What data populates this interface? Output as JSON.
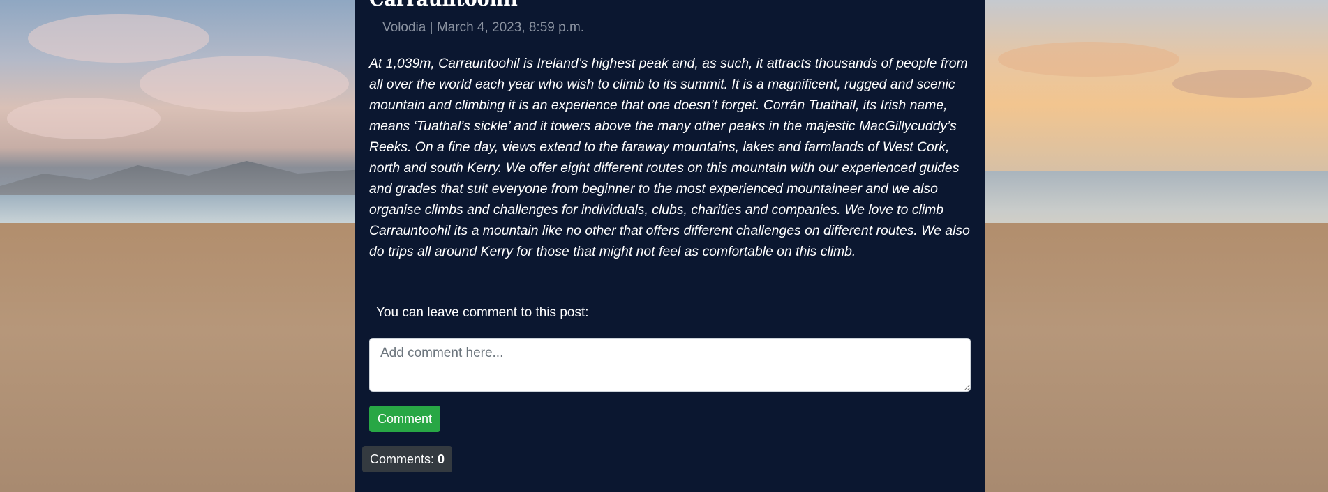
{
  "post": {
    "title": "Carrauntoohil",
    "author": "Volodia",
    "separator": "|",
    "date": "March 4, 2023, 8:59 p.m.",
    "body": "At 1,039m, Carrauntoohil is Ireland’s highest peak and, as such, it attracts thousands of people from all over the world each year who wish to climb to its summit. It is a magnificent, rugged and scenic mountain and climbing it is an experience that one doesn’t forget. Corrán Tuathail, its Irish name, means ‘Tuathal’s sickle’ and it towers above the many other peaks in the majestic MacGillycuddy’s Reeks. On a fine day, views extend to the faraway mountains, lakes and farmlands of West Cork, north and south Kerry. We offer eight different routes on this mountain with our experienced guides and grades that suit everyone from beginner to the most experienced mountaineer and we also organise climbs and challenges for individuals, clubs, charities and companies. We love to climb Carrauntoohil its a mountain like no other that offers different challenges on different routes. We also do trips all around Kerry for those that might not feel as comfortable on this climb."
  },
  "comment_form": {
    "label": "You can leave comment to this post:",
    "placeholder": "Add comment here...",
    "value": "",
    "submit_label": "Comment"
  },
  "comments": {
    "label": "Comments:",
    "count": "0"
  },
  "colors": {
    "panel_background": "#0b1730",
    "button_green": "#28a745",
    "badge_dark": "#343a40",
    "meta_gray": "#8a92a0"
  }
}
